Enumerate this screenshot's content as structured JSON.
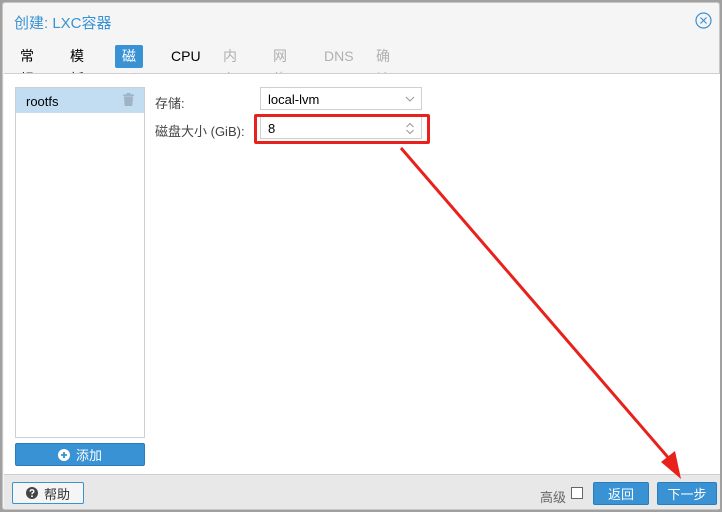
{
  "window": {
    "title": "创建: LXC容器",
    "close_icon": "close-circle-icon"
  },
  "tabs": [
    {
      "label": "常规",
      "state": "normal"
    },
    {
      "label": "模板",
      "state": "normal"
    },
    {
      "label": "磁盘",
      "state": "active"
    },
    {
      "label": "CPU",
      "state": "normal"
    },
    {
      "label": "内存",
      "state": "disabled"
    },
    {
      "label": "网络",
      "state": "disabled"
    },
    {
      "label": "DNS",
      "state": "disabled"
    },
    {
      "label": "确认",
      "state": "disabled"
    }
  ],
  "disks": {
    "items": [
      {
        "name": "rootfs",
        "selected": true,
        "delete_icon": "trash-icon"
      }
    ],
    "add_label": "添加",
    "add_icon": "plus-circle-icon"
  },
  "form": {
    "storage_label": "存储:",
    "storage_value": "local-lvm",
    "size_label": "磁盘大小 (GiB):",
    "size_value": "8"
  },
  "annotation": {
    "highlight_color": "#e8211c",
    "arrow_color": "#e8211c"
  },
  "footer": {
    "help_label": "帮助",
    "help_icon": "question-circle-icon",
    "advanced_label": "高级",
    "advanced_checked": false,
    "back_label": "返回",
    "next_label": "下一步"
  },
  "colors": {
    "accent": "#3892d4",
    "selected_row": "#c2ddf2"
  }
}
